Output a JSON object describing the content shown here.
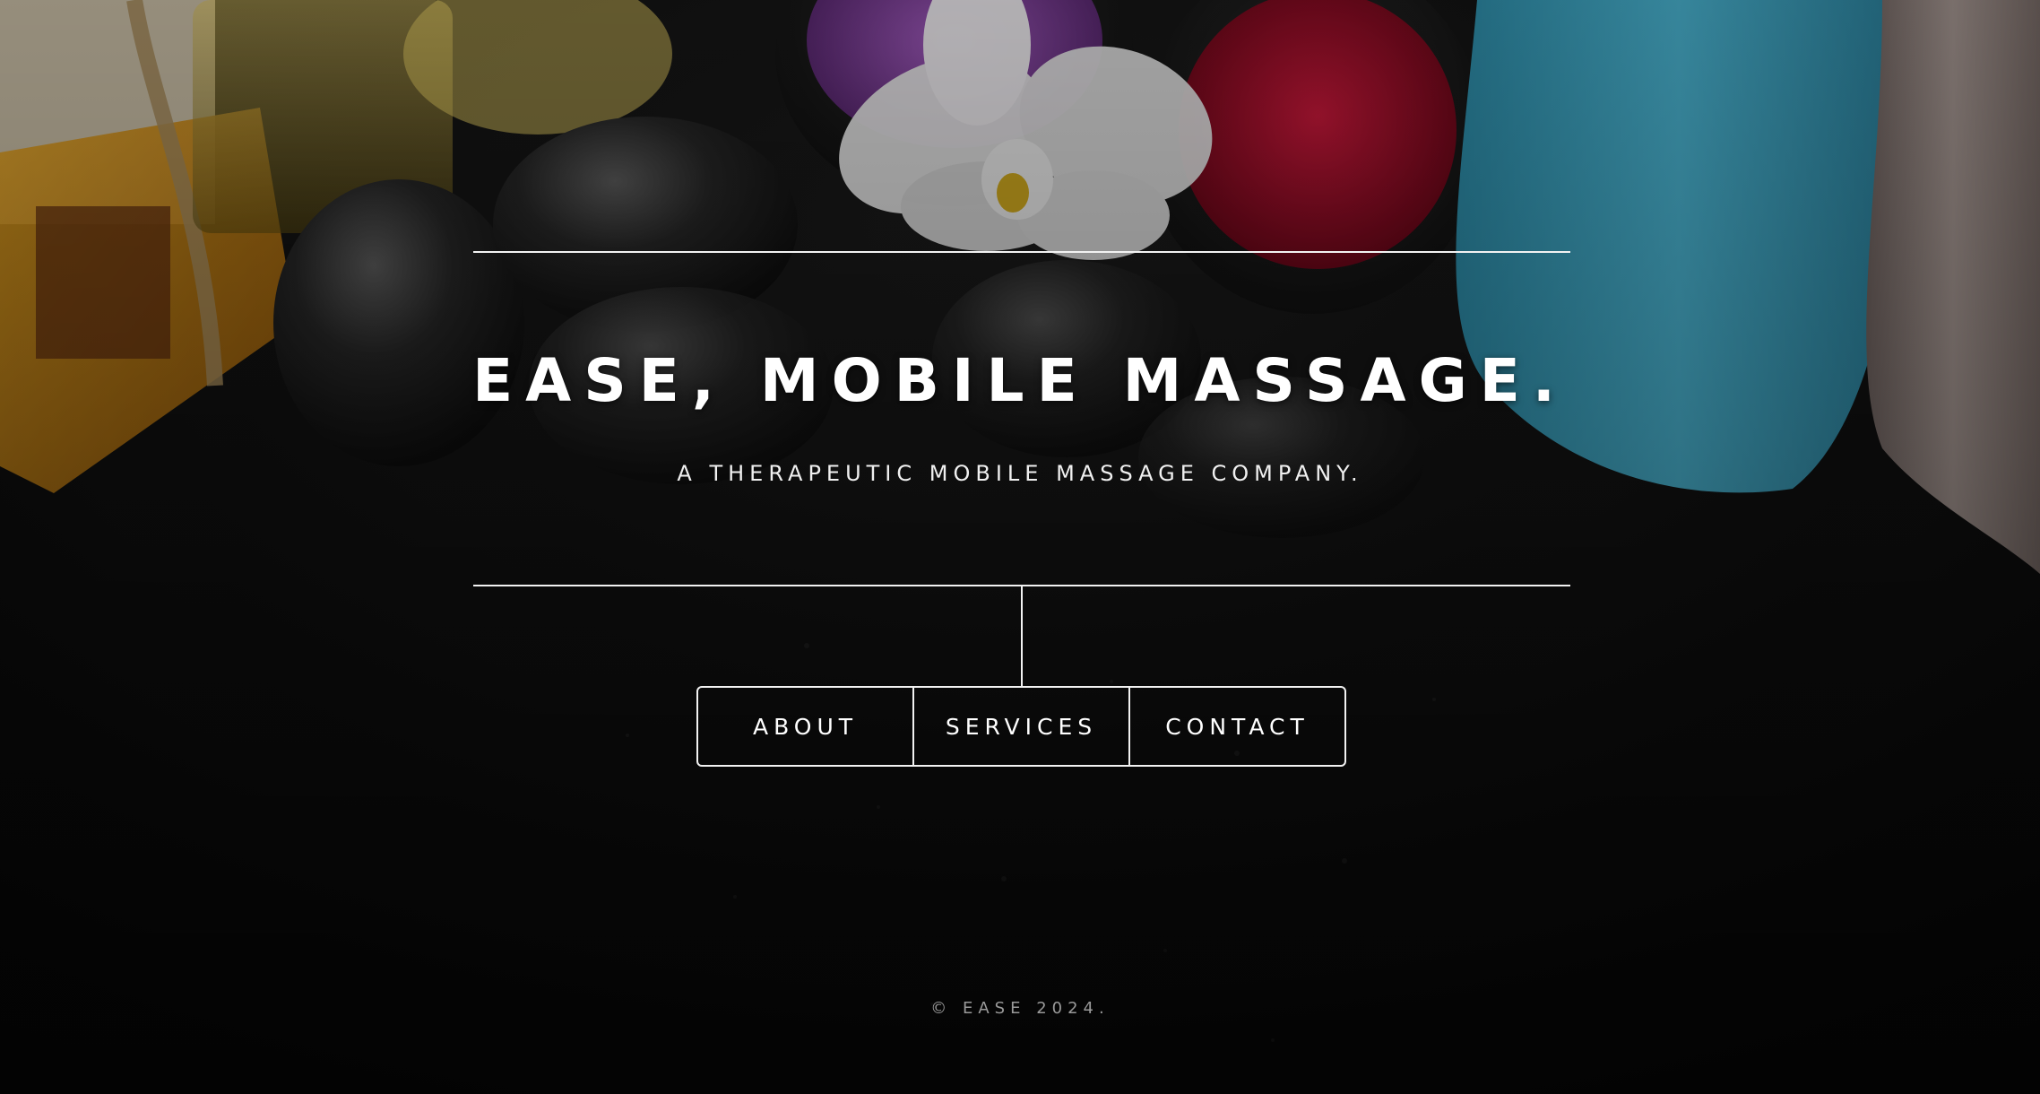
{
  "hero": {
    "title": "EASE, MOBILE MASSAGE.",
    "subtitle": "A THERAPEUTIC MOBILE MASSAGE COMPANY."
  },
  "nav": {
    "items": [
      {
        "label": "ABOUT"
      },
      {
        "label": "SERVICES"
      },
      {
        "label": "CONTACT"
      }
    ]
  },
  "footer": {
    "copyright": "© EASE 2024."
  },
  "colors": {
    "text": "#ffffff",
    "lines": "#f2f2f2",
    "footer_text": "#9a9a9a",
    "background": "#0b0b0b",
    "towel_blue": "#3fa3bf",
    "towel_gray": "#8c7e7a",
    "salt_red": "#b0102a",
    "salt_purple": "#8a3fa0"
  }
}
